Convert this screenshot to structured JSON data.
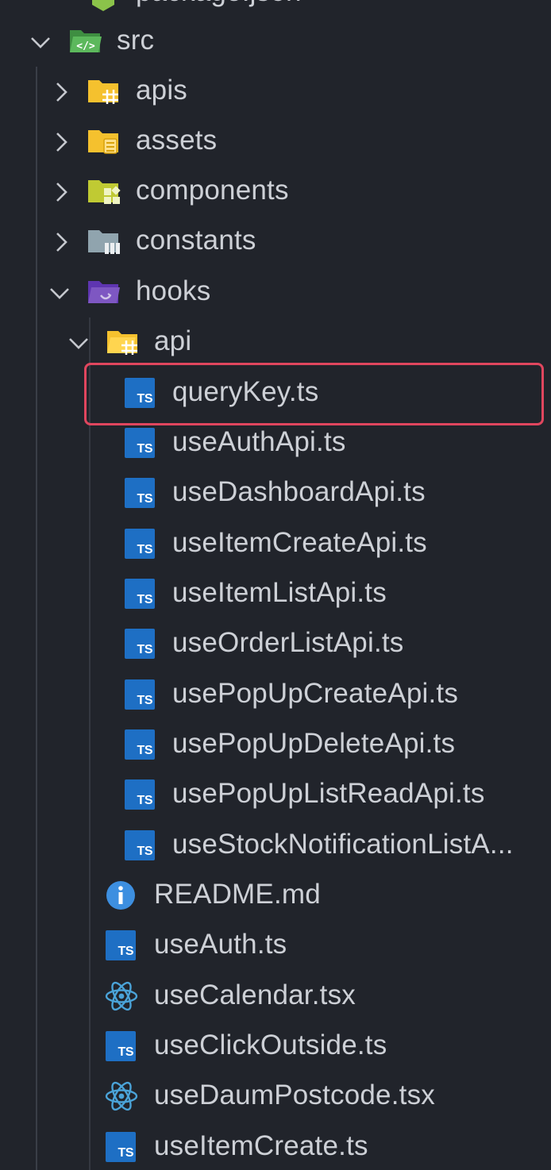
{
  "explorer": {
    "cut_top_label": "package.json",
    "src": {
      "label": "src",
      "expanded": true
    },
    "folders": {
      "apis": "apis",
      "assets": "assets",
      "components": "components",
      "constants": "constants",
      "hooks": "hooks",
      "api": "api"
    },
    "api_files": [
      "queryKey.ts",
      "useAuthApi.ts",
      "useDashboardApi.ts",
      "useItemCreateApi.ts",
      "useItemListApi.ts",
      "useOrderListApi.ts",
      "usePopUpCreateApi.ts",
      "usePopUpDeleteApi.ts",
      "usePopUpListReadApi.ts",
      "useStockNotificationListA..."
    ],
    "hooks_files": [
      {
        "label": "README.md",
        "icon": "info-icon"
      },
      {
        "label": "useAuth.ts",
        "icon": "typescript-icon"
      },
      {
        "label": "useCalendar.tsx",
        "icon": "react-icon"
      },
      {
        "label": "useClickOutside.ts",
        "icon": "typescript-icon"
      },
      {
        "label": "useDaumPostcode.tsx",
        "icon": "react-icon"
      },
      {
        "label": "useItemCreate.ts",
        "icon": "typescript-icon"
      }
    ],
    "ts_badge": "TS",
    "selected_file": "queryKey.ts"
  },
  "colors": {
    "background": "#21242b",
    "highlight_border": "#e0465e",
    "ts_blue": "#1e6fc4",
    "react_blue": "#4aa3d8",
    "folder_yellow": "#f5c12e",
    "folder_green": "#4caf50",
    "folder_lime": "#c0ca33",
    "folder_gray": "#90a4ae",
    "folder_purple": "#7e57c2"
  }
}
